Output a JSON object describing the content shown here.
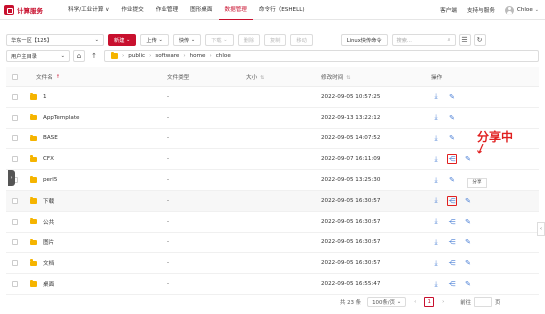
{
  "brand": {
    "name": "计算服务"
  },
  "nav": {
    "items": [
      {
        "label": "科学/工业计算 ∨"
      },
      {
        "label": "作业提交"
      },
      {
        "label": "作业管理"
      },
      {
        "label": "图形桌面"
      },
      {
        "label": "数据管理"
      },
      {
        "label": "命令行（ESHELL)"
      }
    ],
    "active_index": 4
  },
  "topright": {
    "client": "客户端",
    "support": "支持与服务",
    "user": "Chloe"
  },
  "toolbar": {
    "region": "华东一区【125】",
    "new_label": "新建",
    "upload_label": "上传",
    "quick_label": "快传",
    "download_label": "下载",
    "delete_label": "删除",
    "copy_label": "复制",
    "move_label": "移动",
    "linux_label": "Linux快传命令",
    "search_placeholder": "搜索..."
  },
  "pathbar": {
    "root_select": "用户主目录",
    "segments": [
      "public",
      "software",
      "home",
      "chloe"
    ]
  },
  "table": {
    "headers": {
      "name": "文件名",
      "type": "文件类型",
      "size": "大小",
      "time": "修改时间",
      "actions": "操作"
    },
    "rows": [
      {
        "name": "1",
        "type": "-",
        "time": "2022-09-05 10:57:25"
      },
      {
        "name": "AppTemplate",
        "type": "-",
        "time": "2022-09-13 13:22:12"
      },
      {
        "name": "BASE",
        "type": "-",
        "time": "2022-09-05 14:07:52"
      },
      {
        "name": "CFX",
        "type": "-",
        "time": "2022-09-07 16:11:09"
      },
      {
        "name": "perl5",
        "type": "-",
        "time": "2022-09-05 13:25:30"
      },
      {
        "name": "下载",
        "type": "-",
        "time": "2022-09-05 16:30:57"
      },
      {
        "name": "公共",
        "type": "-",
        "time": "2022-09-05 16:30:57"
      },
      {
        "name": "图片",
        "type": "-",
        "time": "2022-09-05 16:30:57"
      },
      {
        "name": "文档",
        "type": "-",
        "time": "2022-09-05 16:30:57"
      },
      {
        "name": "桌面",
        "type": "-",
        "time": "2022-09-05 16:55:47"
      }
    ]
  },
  "annotation": {
    "sharing_label": "分享中",
    "tooltip": "分享"
  },
  "pager": {
    "total": "共 23 条",
    "page_size": "100条/页",
    "current": "1",
    "goto": "前往",
    "page_unit": "页"
  },
  "colors": {
    "brand": "#c8102e",
    "icon_blue": "#4a7fd6",
    "annotation_red": "#e02020",
    "folder": "#f5b400"
  }
}
